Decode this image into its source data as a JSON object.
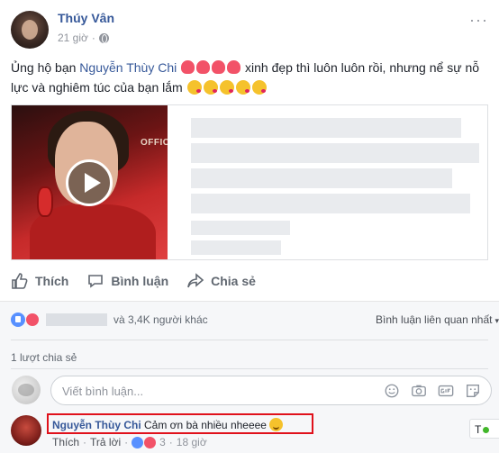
{
  "post": {
    "author": "Thúy Vân",
    "time": "21 giờ",
    "separator": "·",
    "text_prefix": "Ủng hộ bạn ",
    "mention": "Nguyễn Thùy Chi",
    "text_mid": " xinh đẹp thì luôn luôn rồi, nhưng nể sự nỗ lực và nghiêm túc của bạn lắm",
    "more": "···",
    "link_overlay_text": "OFFICIA"
  },
  "actions": {
    "like": "Thích",
    "comment": "Bình luận",
    "share": "Chia sẻ"
  },
  "reactions": {
    "others": "và 3,4K người khác",
    "sort": "Bình luận liên quan nhất",
    "caret": "▾"
  },
  "shares": "1 lượt chia sẻ",
  "comment_input": {
    "placeholder": "Viết bình luận..."
  },
  "reply": {
    "name": "Nguyễn Thùy Chi",
    "text": "Cảm ơn bà nhiều nheeee",
    "like": "Thích",
    "reply_label": "Trả lời",
    "dot": "·",
    "reaction_count": "3",
    "time": "18 giờ"
  },
  "online_chip": {
    "label": "T"
  },
  "icons": {
    "camera": "camera-icon",
    "emoji": "emoji-icon",
    "gif": "gif-icon",
    "sticker": "sticker-icon"
  },
  "colors": {
    "link": "#365899",
    "highlight_border": "#e0111b",
    "like_blue": "#5890ff",
    "love_red": "#f25268"
  }
}
